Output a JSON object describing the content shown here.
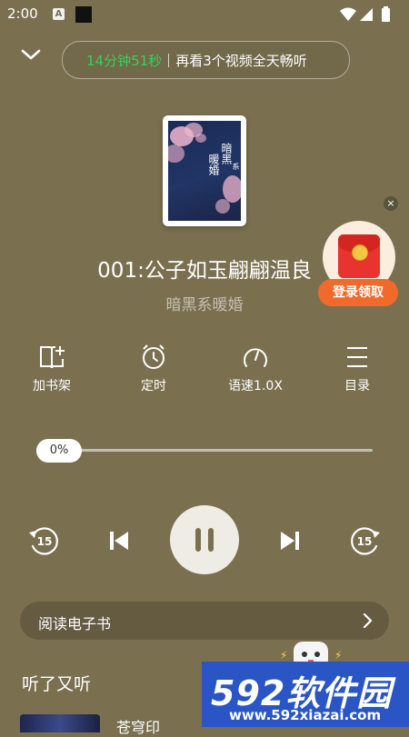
{
  "status_bar": {
    "time": "2:00",
    "badge": "A"
  },
  "promo": {
    "timer": "14分钟51秒",
    "text": "再看3个视频全天畅听"
  },
  "cover": {
    "title_main": "暗黑",
    "title_small": "系",
    "title_line2": "暖婚"
  },
  "track": {
    "title": "001:公子如玉翩翩温良",
    "book": "暗黑系暖婚"
  },
  "red_packet": {
    "close": "×",
    "button": "登录领取"
  },
  "toolbar": [
    {
      "label": "加书架",
      "icon": "add-to-shelf-icon"
    },
    {
      "label": "定时",
      "icon": "alarm-clock-icon"
    },
    {
      "label": "语速1.0X",
      "icon": "speed-gauge-icon"
    },
    {
      "label": "目录",
      "icon": "list-menu-icon"
    }
  ],
  "progress": {
    "label": "0%",
    "value": 0
  },
  "playback": {
    "rewind_seconds": "15",
    "forward_seconds": "15",
    "state": "playing"
  },
  "ebook": {
    "label": "阅读电子书"
  },
  "section": {
    "title": "听了又听"
  },
  "list": {
    "first_item_partial": "苍穹印"
  },
  "watermark": {
    "brand_num": "592",
    "brand_text": "软件园",
    "url": "www.592xiazai.com"
  },
  "colors": {
    "background": "#7a7050",
    "timer_green": "#35d15c",
    "red_packet": "#e8332e",
    "login_orange": "#f06a2b"
  }
}
